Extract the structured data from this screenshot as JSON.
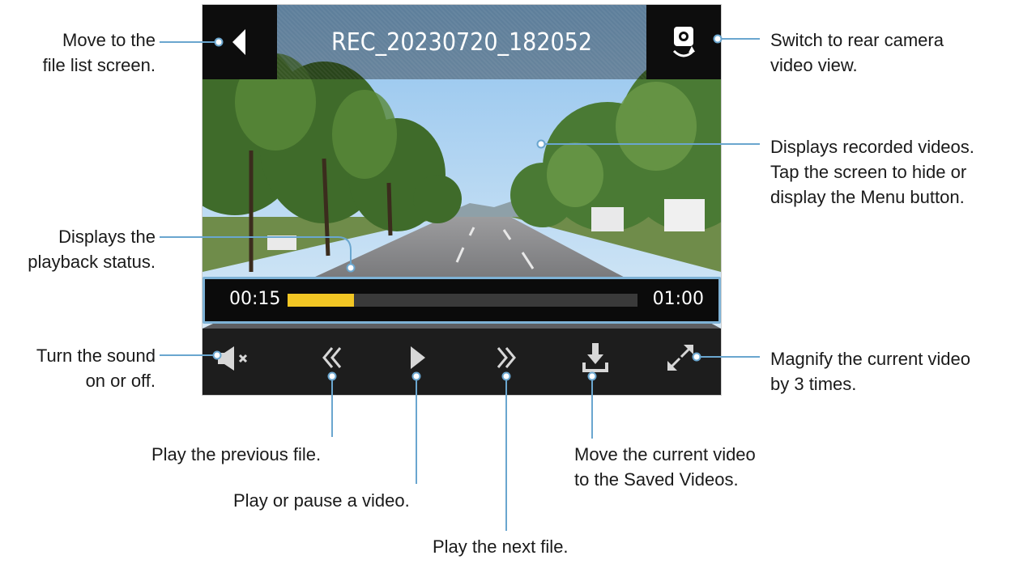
{
  "player": {
    "filename": "REC_20230720_182052",
    "current_time": "00:15",
    "total_time": "01:00",
    "progress_fraction": 0.19
  },
  "icons": {
    "back": "back-arrow-icon",
    "rear_camera": "rear-camera-switch-icon",
    "mute": "speaker-muted-icon",
    "previous": "double-chevron-left-icon",
    "play": "play-icon",
    "next": "double-chevron-right-icon",
    "save": "download-icon",
    "magnify": "expand-icon"
  },
  "callouts": {
    "back": [
      "Move to the",
      "file list screen."
    ],
    "rear_camera": [
      "Switch to rear camera",
      "video view."
    ],
    "video": [
      "Displays recorded videos.",
      "Tap the screen to hide or",
      "display the Menu button."
    ],
    "playback_status": [
      "Displays the",
      "playback status."
    ],
    "sound": [
      "Turn the sound",
      "on or off."
    ],
    "magnify": [
      "Magnify the current video",
      "by 3 times."
    ],
    "previous": "Play the previous file.",
    "play_pause": "Play or pause a video.",
    "save": [
      "Move the current video",
      "to the Saved Videos."
    ],
    "next": "Play the next file."
  },
  "colors": {
    "callout_line": "#6aa6cf",
    "progress_fill": "#f2c624",
    "progress_border": "#7eb2d6"
  }
}
